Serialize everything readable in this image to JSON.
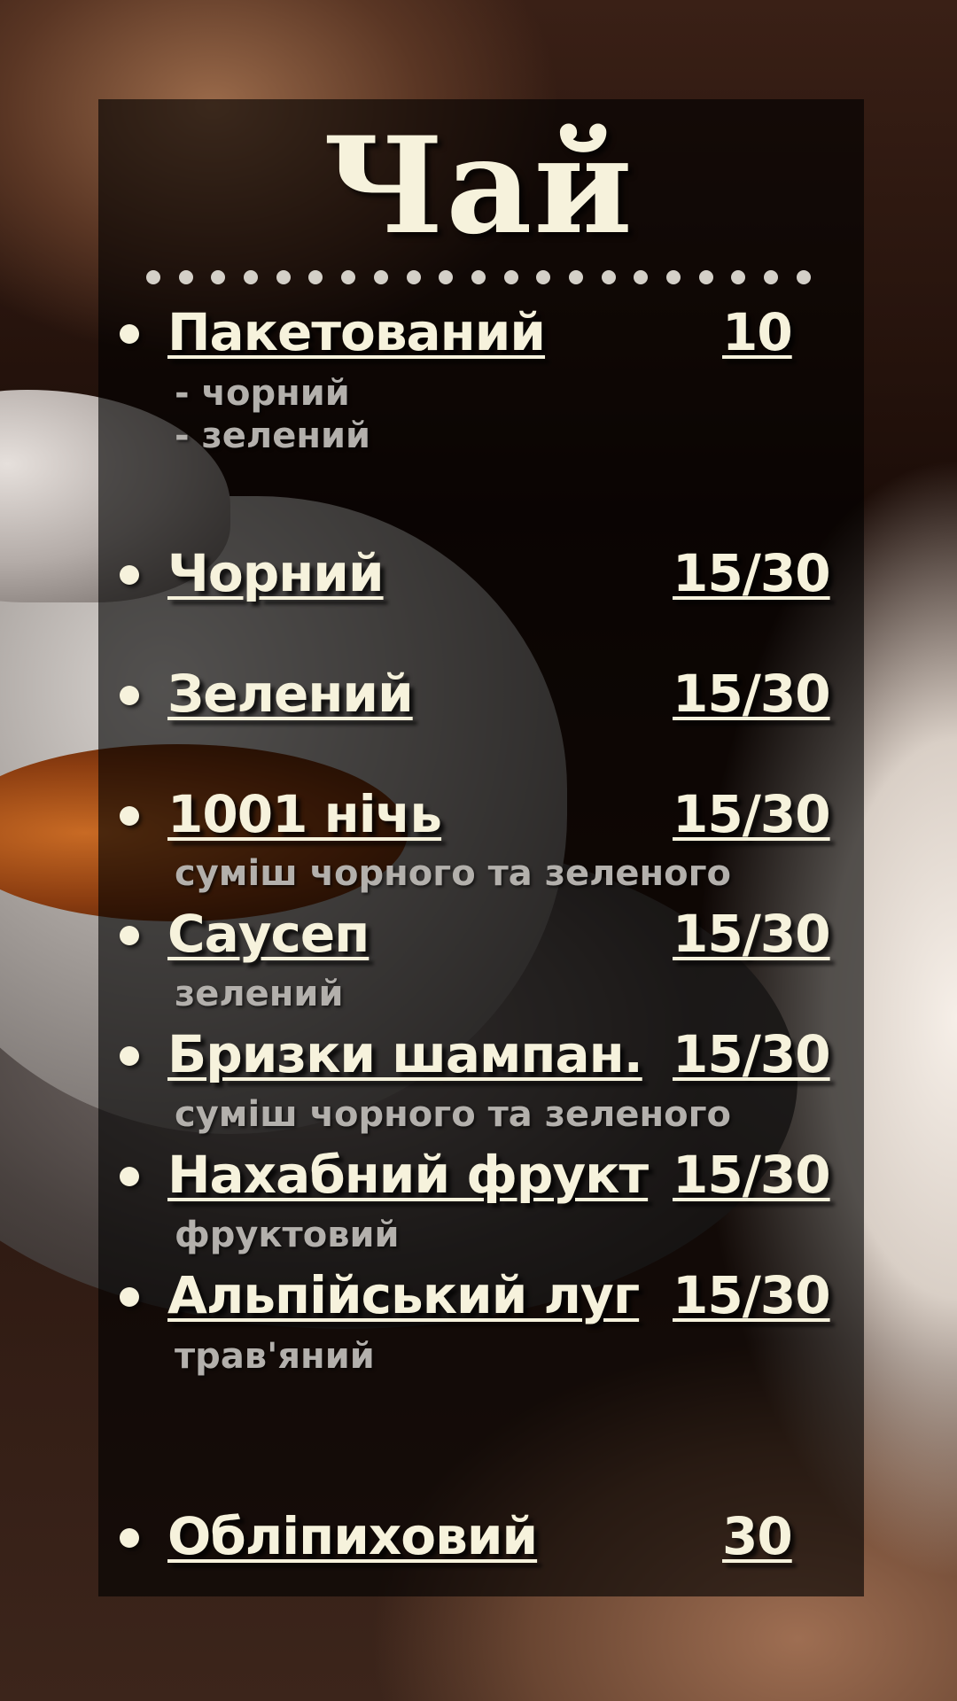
{
  "title": "Чай",
  "items": [
    {
      "name": "Пакетований",
      "price": "10",
      "notes": [
        "- чорний",
        "- зелений"
      ]
    },
    {
      "name": "Чорний",
      "price": "15/30"
    },
    {
      "name": "Зелений",
      "price": "15/30"
    },
    {
      "name": "1001 нічь",
      "price": "15/30",
      "notes": [
        "суміш чорного та зеленого"
      ]
    },
    {
      "name": "Саусеп",
      "price": "15/30",
      "notes": [
        "зелений"
      ]
    },
    {
      "name": "Бризки шампан.",
      "price": "15/30",
      "notes": [
        "суміш чорного та зеленого"
      ]
    },
    {
      "name": "Нахабний фрукт",
      "price": "15/30",
      "notes": [
        "фруктовий"
      ]
    },
    {
      "name": "Альпійський луг",
      "price": "15/30",
      "notes": [
        "трав'яний"
      ]
    },
    {
      "name": "Обліпиховий",
      "price": "30"
    }
  ]
}
